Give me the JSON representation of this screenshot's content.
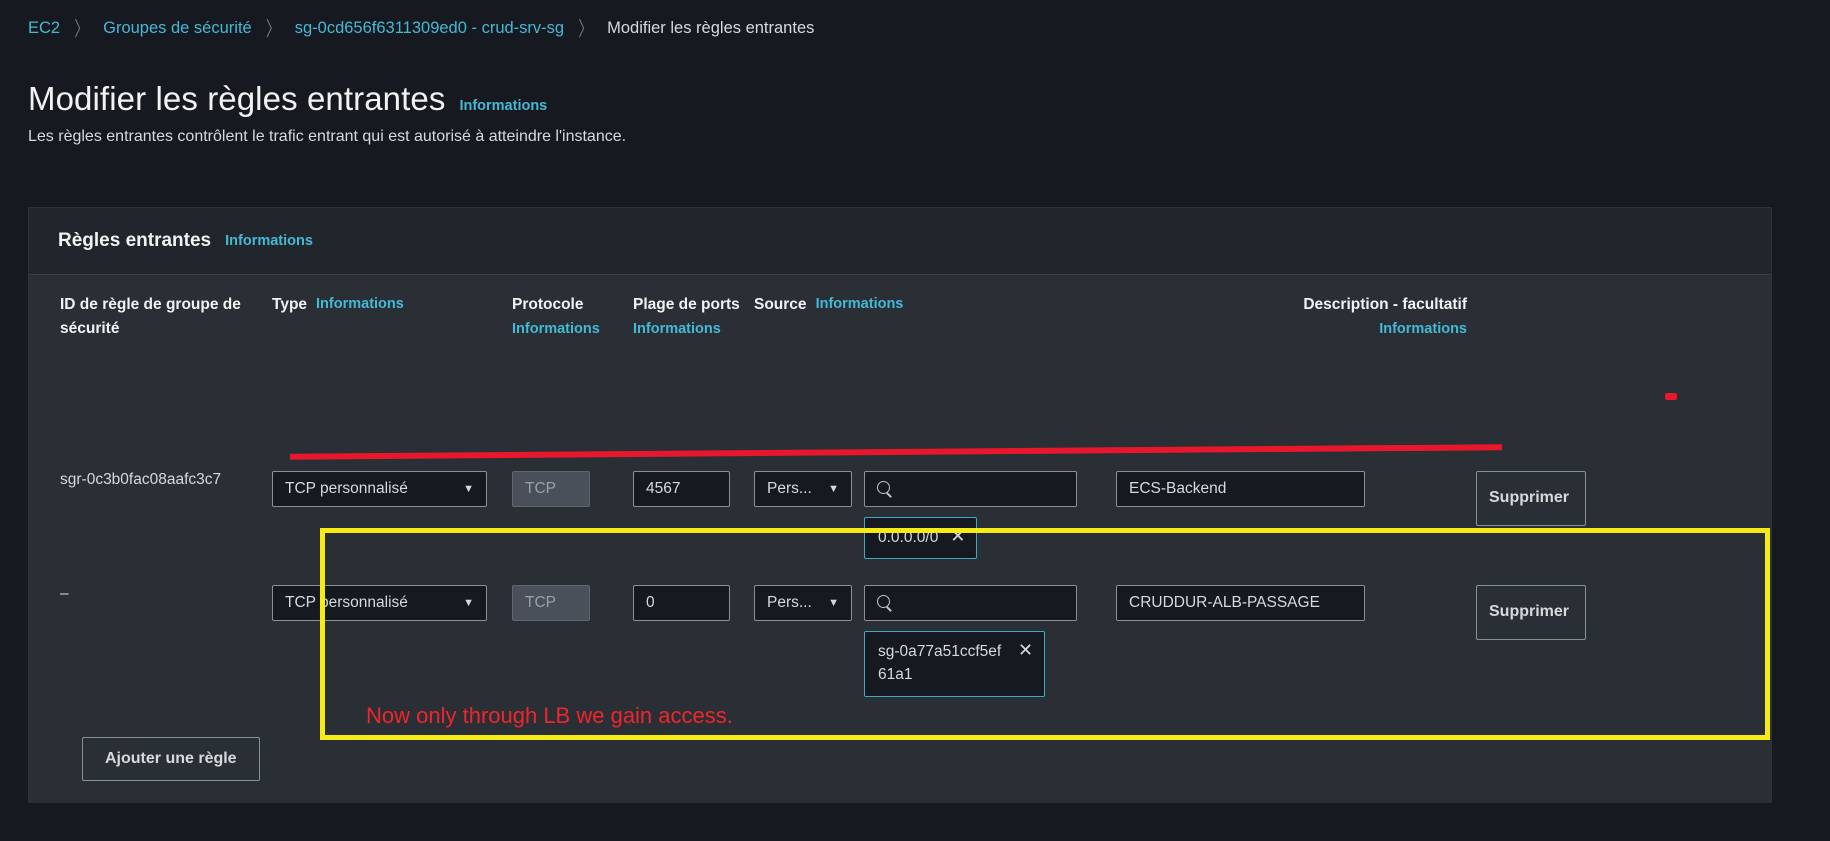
{
  "breadcrumb": {
    "items": [
      {
        "label": "EC2",
        "current": false
      },
      {
        "label": "Groupes de sécurité",
        "current": false
      },
      {
        "label": "sg-0cd656f6311309ed0 - crud-srv-sg",
        "current": false
      },
      {
        "label": "Modifier les règles entrantes",
        "current": true
      }
    ],
    "separator": "〉"
  },
  "header": {
    "title": "Modifier les règles entrantes",
    "info_label": "Informations",
    "subtitle": "Les règles entrantes contrôlent le trafic entrant qui est autorisé à atteindre l'instance."
  },
  "panel": {
    "title": "Règles entrantes",
    "info_label": "Informations"
  },
  "table": {
    "headers": {
      "rule_id": "ID de règle de groupe de sécurité",
      "type": "Type",
      "type_info": "Informations",
      "protocol": "Protocole",
      "protocol_info": "Informations",
      "port_range": "Plage de ports",
      "port_info": "Informations",
      "source": "Source",
      "source_info": "Informations",
      "description": "Description - facultatif",
      "description_info": "Informations"
    },
    "rows": [
      {
        "rule_id": "sgr-0c3b0fac08aafc3c7",
        "type": "TCP personnalisé",
        "protocol": "TCP",
        "port_range": "4567",
        "source_type": "Pers...",
        "source_search": "",
        "source_token": "0.0.0.0/0",
        "description": "ECS-Backend",
        "delete_label": "Supprimer"
      },
      {
        "rule_id": "–",
        "type": "TCP personnalisé",
        "protocol": "TCP",
        "port_range": "0",
        "source_type": "Pers...",
        "source_search": "",
        "source_token": "sg-0a77a51ccf5ef61a1",
        "description": "CRUDDUR-ALB-PASSAGE",
        "delete_label": "Supprimer"
      }
    ],
    "add_rule_label": "Ajouter une règle"
  },
  "annotations": {
    "note_text": "Now only through LB we gain access.",
    "highlight_color": "#f6eb14",
    "strike_color": "#e8172c",
    "note_color": "#f0262a"
  },
  "icons": {
    "caret_down": "▼",
    "close": "✕"
  }
}
